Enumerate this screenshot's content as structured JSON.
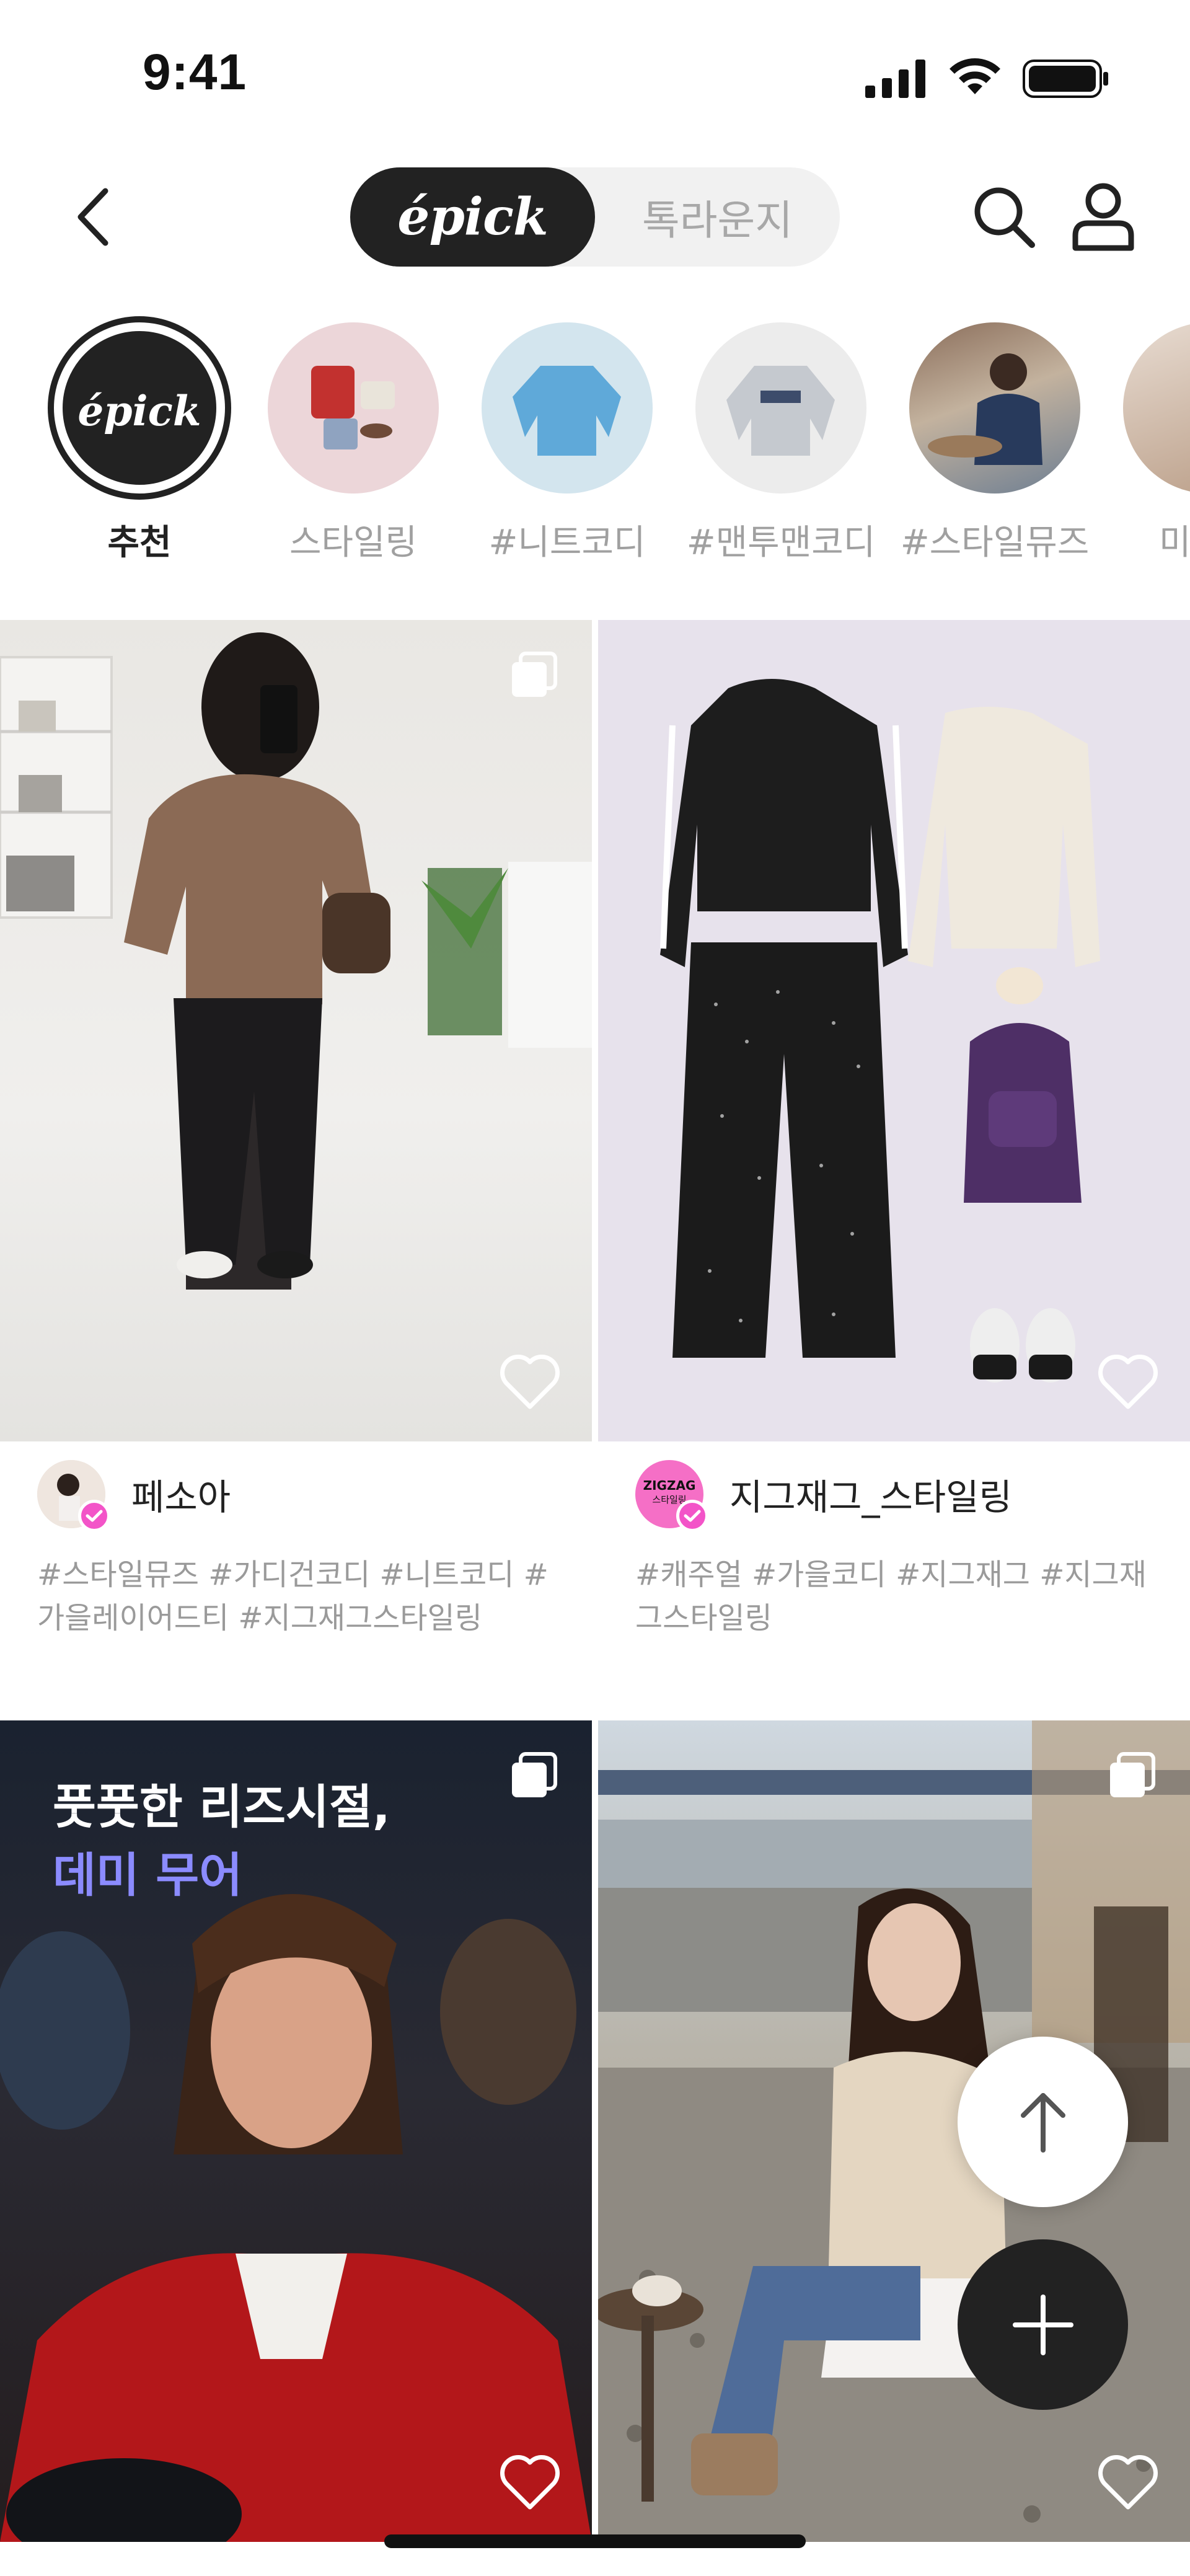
{
  "status_bar": {
    "time": "9:41"
  },
  "header": {
    "back_icon": "chevron-left-icon",
    "segments": [
      {
        "label": "épick",
        "active": true
      },
      {
        "label": "톡라운지",
        "active": false
      }
    ],
    "search_icon": "search-icon",
    "profile_icon": "user-icon"
  },
  "stories": [
    {
      "label": "추천",
      "logo_text": "épick",
      "active": true
    },
    {
      "label": "스타일링"
    },
    {
      "label": "#니트코디"
    },
    {
      "label": "#맨투맨코디"
    },
    {
      "label": "#스타일뮤즈"
    },
    {
      "label": "미"
    }
  ],
  "feed": [
    {
      "author": "페소아",
      "verified": true,
      "tags": "#스타일뮤즈 #가디건코디 #니트코디 #가을레이어드티 #지그재그스타일링"
    },
    {
      "author": "지그재그_스타일링",
      "avatar_text": "ZIGZAG",
      "avatar_sub": "스타일링",
      "verified": true,
      "tags": "#캐주얼 #가을코디 #지그재그 #지그재그스타일링"
    },
    {
      "caption_line1": "풋풋한 리즈시절,",
      "caption_line2": "데미 무어"
    },
    {}
  ],
  "fab": {
    "scroll_top_icon": "arrow-up-icon",
    "add_icon": "plus-icon"
  },
  "colors": {
    "accent_dark": "#222222",
    "verified_pink": "#f354c8",
    "caption_purple": "#8b8bff"
  }
}
